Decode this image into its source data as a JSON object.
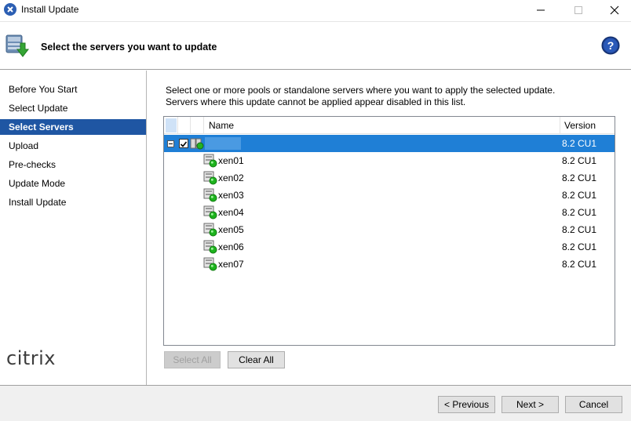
{
  "window": {
    "title": "Install Update"
  },
  "header": {
    "title": "Select the servers you want to update"
  },
  "sidebar": {
    "items": [
      {
        "label": "Before You Start",
        "active": false
      },
      {
        "label": "Select Update",
        "active": false
      },
      {
        "label": "Select Servers",
        "active": true
      },
      {
        "label": "Upload",
        "active": false
      },
      {
        "label": "Pre-checks",
        "active": false
      },
      {
        "label": "Update Mode",
        "active": false
      },
      {
        "label": "Install Update",
        "active": false
      }
    ],
    "logo": "citrix"
  },
  "main": {
    "description_line1": "Select one or more pools or standalone servers where you want to apply the selected update.",
    "description_line2": "Servers where this update cannot be applied appear disabled in this list.",
    "columns": {
      "name": "Name",
      "version": "Version"
    },
    "pool": {
      "name": "",
      "version": "8.2 CU1",
      "checked": true,
      "expanded": true
    },
    "servers": [
      {
        "name": "xen01",
        "version": "8.2 CU1"
      },
      {
        "name": "xen02",
        "version": "8.2 CU1"
      },
      {
        "name": "xen03",
        "version": "8.2 CU1"
      },
      {
        "name": "xen04",
        "version": "8.2 CU1"
      },
      {
        "name": "xen05",
        "version": "8.2 CU1"
      },
      {
        "name": "xen06",
        "version": "8.2 CU1"
      },
      {
        "name": "xen07",
        "version": "8.2 CU1"
      }
    ],
    "select_all_label": "Select All",
    "clear_all_label": "Clear All"
  },
  "footer": {
    "previous_label": "< Previous",
    "next_label": "Next >",
    "cancel_label": "Cancel"
  },
  "colors": {
    "accent": "#1f56a3",
    "row_selected": "#1f7fd6",
    "status_ok": "#1db31d"
  },
  "icons": {
    "app": "citrix-close-icon",
    "header": "update-package-icon",
    "help": "help-icon",
    "pool": "pool-icon",
    "server": "server-running-icon"
  }
}
